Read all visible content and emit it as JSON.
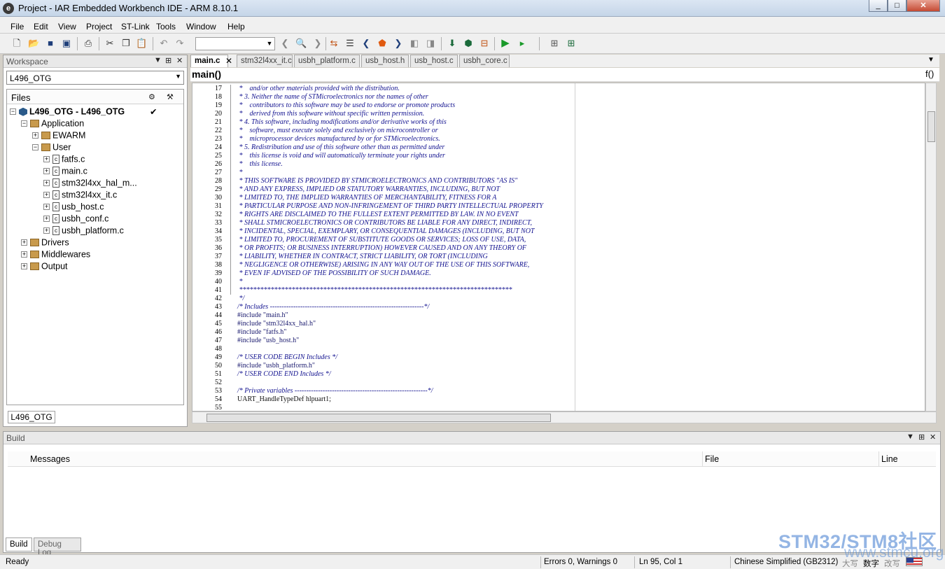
{
  "window": {
    "title": "Project - IAR Embedded Workbench IDE - ARM 8.10.1",
    "controls": [
      "_",
      "□",
      "✕"
    ]
  },
  "menu": [
    "File",
    "Edit",
    "View",
    "Project",
    "ST-Link",
    "Tools",
    "Window",
    "Help"
  ],
  "toolbar": {
    "icons": [
      "new-file-icon",
      "open-icon",
      "save-icon",
      "save-all-icon",
      "print-icon",
      "cut-icon",
      "copy-icon",
      "paste-icon",
      "undo-icon",
      "redo-icon",
      "back-icon",
      "find-icon",
      "forward-icon",
      "toggle-bookmark-icon",
      "bookmark-list-icon",
      "prev-bookmark-icon",
      "stop-icon",
      "next-bookmark-icon",
      "compile-icon",
      "make-icon",
      "make-all-icon",
      "debug-icon",
      "download-icon",
      "go-icon",
      "run-icon",
      "layout-icon",
      "layout2-icon"
    ]
  },
  "workspace": {
    "title": "Workspace",
    "selected_config": "L496_OTG",
    "files_label": "Files",
    "tree": [
      {
        "label": "L496_OTG - L496_OTG",
        "type": "project",
        "bold": true,
        "check": "✔"
      },
      {
        "label": "Application",
        "type": "folder",
        "exp": "−"
      },
      {
        "label": "EWARM",
        "type": "folder",
        "exp": "+"
      },
      {
        "label": "User",
        "type": "folder",
        "exp": "−"
      },
      {
        "label": "fatfs.c",
        "type": "file",
        "exp": "+"
      },
      {
        "label": "main.c",
        "type": "file",
        "exp": "+"
      },
      {
        "label": "stm32l4xx_hal_m...",
        "type": "file",
        "exp": "+"
      },
      {
        "label": "stm32l4xx_it.c",
        "type": "file",
        "exp": "+"
      },
      {
        "label": "usb_host.c",
        "type": "file",
        "exp": "+"
      },
      {
        "label": "usbh_conf.c",
        "type": "file",
        "exp": "+"
      },
      {
        "label": "usbh_platform.c",
        "type": "file",
        "exp": "+"
      },
      {
        "label": "Drivers",
        "type": "folder",
        "exp": "+"
      },
      {
        "label": "Middlewares",
        "type": "folder",
        "exp": "+"
      },
      {
        "label": "Output",
        "type": "folder",
        "exp": "+"
      }
    ],
    "tab": "L496_OTG"
  },
  "editor": {
    "tabs": [
      "main.c",
      "stm32l4xx_it.c",
      "usbh_platform.c",
      "usb_host.h",
      "usb_host.c",
      "usbh_core.c"
    ],
    "function": "main()",
    "func_icon": "f()",
    "lines": [
      {
        "n": "17",
        "t": " *    and/or other materials provided with the distribution.",
        "c": "cm"
      },
      {
        "n": "18",
        "t": " * 3. Neither the name of STMicroelectronics nor the names of other",
        "c": "cm"
      },
      {
        "n": "19",
        "t": " *    contributors to this software may be used to endorse or promote products",
        "c": "cm"
      },
      {
        "n": "20",
        "t": " *    derived from this software without specific written permission.",
        "c": "cm"
      },
      {
        "n": "21",
        "t": " * 4. This software, including modifications and/or derivative works of this",
        "c": "cm"
      },
      {
        "n": "22",
        "t": " *    software, must execute solely and exclusively on microcontroller or",
        "c": "cm"
      },
      {
        "n": "23",
        "t": " *    microprocessor devices manufactured by or for STMicroelectronics.",
        "c": "cm"
      },
      {
        "n": "24",
        "t": " * 5. Redistribution and use of this software other than as permitted under",
        "c": "cm"
      },
      {
        "n": "25",
        "t": " *    this license is void and will automatically terminate your rights under",
        "c": "cm"
      },
      {
        "n": "26",
        "t": " *    this license.",
        "c": "cm"
      },
      {
        "n": "27",
        "t": " *",
        "c": "cm"
      },
      {
        "n": "28",
        "t": " * THIS SOFTWARE IS PROVIDED BY STMICROELECTRONICS AND CONTRIBUTORS \"AS IS\"",
        "c": "cm"
      },
      {
        "n": "29",
        "t": " * AND ANY EXPRESS, IMPLIED OR STATUTORY WARRANTIES, INCLUDING, BUT NOT",
        "c": "cm"
      },
      {
        "n": "30",
        "t": " * LIMITED TO, THE IMPLIED WARRANTIES OF MERCHANTABILITY, FITNESS FOR A",
        "c": "cm"
      },
      {
        "n": "31",
        "t": " * PARTICULAR PURPOSE AND NON-INFRINGEMENT OF THIRD PARTY INTELLECTUAL PROPERTY",
        "c": "cm"
      },
      {
        "n": "32",
        "t": " * RIGHTS ARE DISCLAIMED TO THE FULLEST EXTENT PERMITTED BY LAW. IN NO EVENT",
        "c": "cm"
      },
      {
        "n": "33",
        "t": " * SHALL STMICROELECTRONICS OR CONTRIBUTORS BE LIABLE FOR ANY DIRECT, INDIRECT,",
        "c": "cm"
      },
      {
        "n": "34",
        "t": " * INCIDENTAL, SPECIAL, EXEMPLARY, OR CONSEQUENTIAL DAMAGES (INCLUDING, BUT NOT",
        "c": "cm"
      },
      {
        "n": "35",
        "t": " * LIMITED TO, PROCUREMENT OF SUBSTITUTE GOODS OR SERVICES; LOSS OF USE, DATA,",
        "c": "cm"
      },
      {
        "n": "36",
        "t": " * OR PROFITS; OR BUSINESS INTERRUPTION) HOWEVER CAUSED AND ON ANY THEORY OF",
        "c": "cm"
      },
      {
        "n": "37",
        "t": " * LIABILITY, WHETHER IN CONTRACT, STRICT LIABILITY, OR TORT (INCLUDING",
        "c": "cm"
      },
      {
        "n": "38",
        "t": " * NEGLIGENCE OR OTHERWISE) ARISING IN ANY WAY OUT OF THE USE OF THIS SOFTWARE,",
        "c": "cm"
      },
      {
        "n": "39",
        "t": " * EVEN IF ADVISED OF THE POSSIBILITY OF SUCH DAMAGE.",
        "c": "cm"
      },
      {
        "n": "40",
        "t": " *",
        "c": "cm"
      },
      {
        "n": "41",
        "t": " ******************************************************************************",
        "c": "cm"
      },
      {
        "n": "42",
        "t": " */",
        "c": "cm"
      },
      {
        "n": "43",
        "t": "/* Includes ------------------------------------------------------------------*/",
        "c": "cm"
      },
      {
        "n": "44",
        "t": "#include \"main.h\"",
        "c": "pp"
      },
      {
        "n": "45",
        "t": "#include \"stm32l4xx_hal.h\"",
        "c": "pp"
      },
      {
        "n": "46",
        "t": "#include \"fatfs.h\"",
        "c": "pp"
      },
      {
        "n": "47",
        "t": "#include \"usb_host.h\"",
        "c": "pp"
      },
      {
        "n": "48",
        "t": "",
        "c": "tx"
      },
      {
        "n": "49",
        "t": "/* USER CODE BEGIN Includes */",
        "c": "cm"
      },
      {
        "n": "50",
        "t": "#include \"usbh_platform.h\"",
        "c": "pp"
      },
      {
        "n": "51",
        "t": "/* USER CODE END Includes */",
        "c": "cm"
      },
      {
        "n": "52",
        "t": "",
        "c": "tx"
      },
      {
        "n": "53",
        "t": "/* Private variables ---------------------------------------------------------*/",
        "c": "cm"
      },
      {
        "n": "54",
        "t": "UART_HandleTypeDef hlpuart1;",
        "c": "tx"
      },
      {
        "n": "55",
        "t": "",
        "c": "tx"
      }
    ]
  },
  "build": {
    "title": "Build",
    "columns": {
      "messages": "Messages",
      "file": "File",
      "line": "Line"
    },
    "tabs": [
      "Build",
      "Debug Log"
    ]
  },
  "status": {
    "state": "Ready",
    "errors": "Errors 0, Warnings 0",
    "position": "Ln 95, Col 1",
    "encoding": "Chinese Simplified (GB2312)",
    "ime1": "大写",
    "ime2": "数字",
    "ime3": "改写"
  },
  "watermark": {
    "brand": "STM32/STM8社区",
    "url": "www.stmcu.org"
  }
}
